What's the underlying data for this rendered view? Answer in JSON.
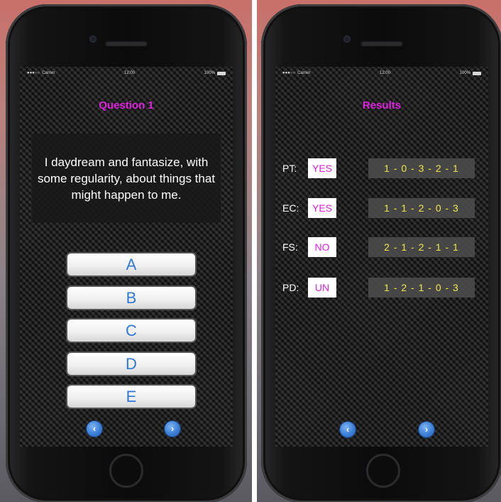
{
  "colors": {
    "title_magenta": "#e020e0",
    "answer_blue": "#2f78d8",
    "score_yellow": "#f2e64a",
    "nav_blue": "#3a7fd8"
  },
  "status_bar": {
    "carrier": "Carrier",
    "time": "12:00",
    "battery": "100%"
  },
  "quiz_screen": {
    "title": "Question 1",
    "question": "I daydream and fantasize, with some regularity, about things  that might happen to me.",
    "answers": [
      "A",
      "B",
      "C",
      "D",
      "E"
    ],
    "nav": {
      "prev_icon": "chevron-left-icon",
      "next_icon": "chevron-right-icon"
    }
  },
  "results_screen": {
    "title": "Results",
    "rows": [
      {
        "label": "PT:",
        "answer": "YES",
        "scores": "1 - 0 - 3 - 2 - 1"
      },
      {
        "label": "EC:",
        "answer": "YES",
        "scores": "1 - 1 - 2 - 0 - 3"
      },
      {
        "label": "FS:",
        "answer": "NO",
        "scores": "2 - 1 - 2 - 1 - 1"
      },
      {
        "label": "PD:",
        "answer": "UN",
        "scores": "1 - 2 - 1 - 0 - 3"
      }
    ],
    "nav": {
      "prev_icon": "chevron-left-icon",
      "next_icon": "chevron-right-icon"
    }
  }
}
